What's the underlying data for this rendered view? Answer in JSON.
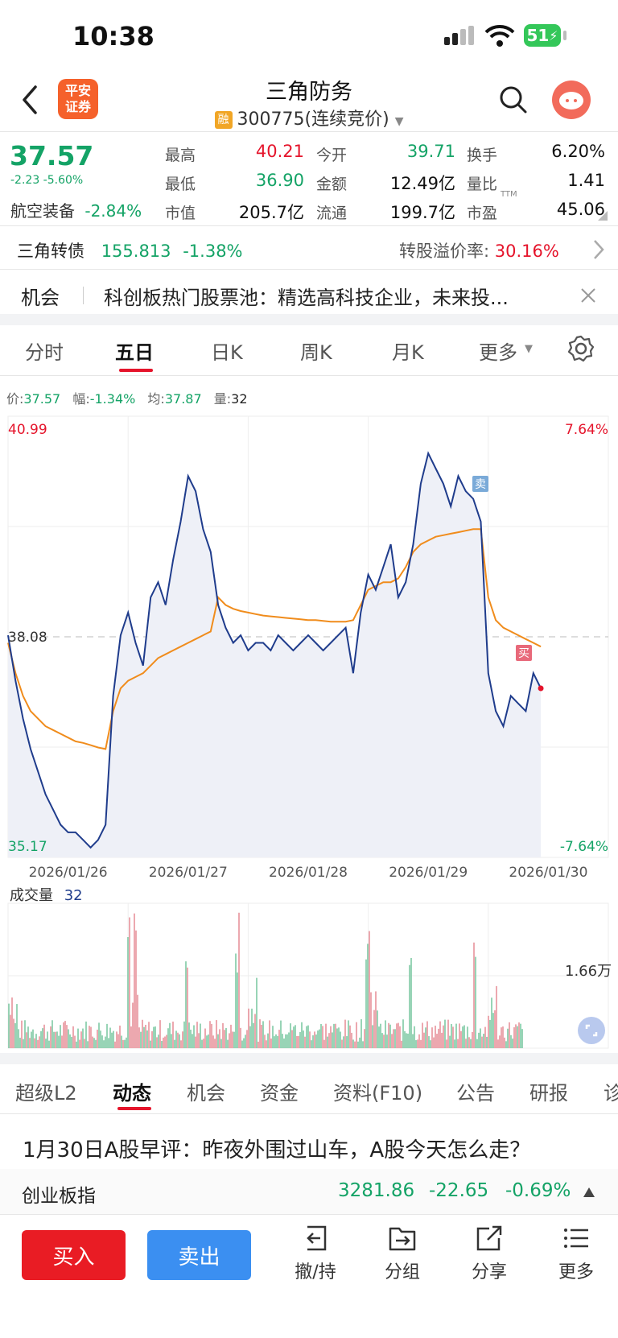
{
  "status_bar": {
    "time": "10:38",
    "battery": "51"
  },
  "header": {
    "logo_text": "平安证券",
    "title": "三角防务",
    "rong_badge": "融",
    "subtitle": "300775(连续竞价)"
  },
  "quote": {
    "price": "37.57",
    "change": "-2.23 -5.60%",
    "sector_name": "航空装备",
    "sector_change": "-2.84%",
    "fields": [
      {
        "label": "最高",
        "value": "40.21",
        "tone": "red"
      },
      {
        "label": "今开",
        "value": "39.71",
        "tone": "green"
      },
      {
        "label": "换手",
        "value": "6.20%",
        "tone": "plain"
      },
      {
        "label": "最低",
        "value": "36.90",
        "tone": "green"
      },
      {
        "label": "金额",
        "value": "12.49亿",
        "tone": "plain"
      },
      {
        "label": "量比",
        "value": "1.41",
        "tone": "plain"
      },
      {
        "label": "市值",
        "value": "205.7亿",
        "tone": "plain"
      },
      {
        "label": "流通",
        "value": "199.7亿",
        "tone": "plain"
      },
      {
        "label": "市盈",
        "value": "45.06",
        "tone": "plain"
      }
    ],
    "ttm_tag": "TTM"
  },
  "bond": {
    "name": "三角转债",
    "price": "155.813",
    "change": "-1.38%",
    "premium_label": "转股溢价率:",
    "premium_value": "30.16%"
  },
  "opportunity": {
    "tag": "机会",
    "text": "科创板热门股票池：精选高科技企业，未来投..."
  },
  "chart_tabs": [
    "分时",
    "五日",
    "日K",
    "周K",
    "月K",
    "更多"
  ],
  "chart_info": {
    "price_label": "价:",
    "price": "37.57",
    "amp_label": "幅:",
    "amp": "-1.34%",
    "avg_label": "均:",
    "avg": "37.87",
    "vol_label": "量:",
    "vol": "32"
  },
  "chart_data": {
    "type": "line",
    "x": [
      "2026/01/26",
      "2026/01/27",
      "2026/01/28",
      "2026/01/29",
      "2026/01/30"
    ],
    "ylim": [
      35.17,
      40.99
    ],
    "y_labels": {
      "top": "40.99",
      "mid": "38.08",
      "bottom": "35.17"
    },
    "pct_labels": {
      "top": "7.64%",
      "bottom": "-7.64%"
    },
    "series": [
      {
        "values": [
          38.1,
          37.5,
          37.0,
          36.6,
          36.3,
          36.0,
          35.8,
          35.6,
          35.5,
          35.5,
          35.4,
          35.3,
          35.4,
          35.6,
          37.3,
          38.1,
          38.4,
          38.0,
          37.7,
          38.6,
          38.8,
          38.5,
          39.1,
          39.6,
          40.2,
          40.0,
          39.5,
          39.2,
          38.5,
          38.2,
          38.0,
          38.1,
          37.9,
          38.0,
          38.0,
          37.9,
          38.1,
          38.0,
          37.9,
          38.0,
          38.1,
          38.0,
          37.9,
          38.0,
          38.1,
          38.2,
          37.6,
          38.4,
          38.9,
          38.7,
          39.0,
          39.3,
          38.6,
          38.8,
          39.3,
          40.1,
          40.5,
          40.3,
          40.1,
          39.8,
          40.2,
          40.0,
          39.9,
          39.6,
          37.6,
          37.1,
          36.9,
          37.3,
          37.2,
          37.1,
          37.6,
          37.4
        ]
      },
      {
        "values": [
          38.0,
          37.6,
          37.3,
          37.1,
          37.0,
          36.9,
          36.85,
          36.8,
          36.75,
          36.7,
          36.68,
          36.65,
          36.62,
          36.6,
          37.1,
          37.4,
          37.5,
          37.55,
          37.6,
          37.7,
          37.8,
          37.85,
          37.9,
          37.95,
          38.0,
          38.05,
          38.1,
          38.15,
          38.6,
          38.5,
          38.45,
          38.42,
          38.4,
          38.38,
          38.36,
          38.35,
          38.34,
          38.33,
          38.32,
          38.31,
          38.3,
          38.3,
          38.29,
          38.28,
          38.28,
          38.28,
          38.3,
          38.5,
          38.7,
          38.75,
          38.8,
          38.8,
          38.85,
          39.0,
          39.2,
          39.3,
          39.35,
          39.4,
          39.42,
          39.44,
          39.46,
          39.48,
          39.5,
          39.5,
          38.6,
          38.3,
          38.2,
          38.15,
          38.1,
          38.05,
          38.0,
          37.95
        ]
      }
    ]
  },
  "volume": {
    "label": "成交量",
    "value": "32",
    "scale_label": "1.66万"
  },
  "news_tabs": [
    "超级L2",
    "动态",
    "机会",
    "资金",
    "资料(F10)",
    "公告",
    "研报",
    "诊"
  ],
  "news_headline": "1月30日A股早评：昨夜外围过山车，A股今天怎么走？",
  "index_ticker": {
    "name": "创业板指",
    "value": "3281.86",
    "change": "-22.65",
    "pct": "-0.69%"
  },
  "bottom_bar": {
    "buy": "买入",
    "sell": "卖出",
    "tools": [
      {
        "label": "撤/持",
        "icon": "undo-icon"
      },
      {
        "label": "分组",
        "icon": "folder-icon"
      },
      {
        "label": "分享",
        "icon": "share-icon"
      },
      {
        "label": "更多",
        "icon": "menu-icon"
      }
    ]
  },
  "markers": {
    "sell": "卖",
    "buy": "买"
  },
  "colors": {
    "up": "#e5142b",
    "down": "#14a366",
    "line": "#1f3c8c",
    "avg": "#f08c1c"
  }
}
